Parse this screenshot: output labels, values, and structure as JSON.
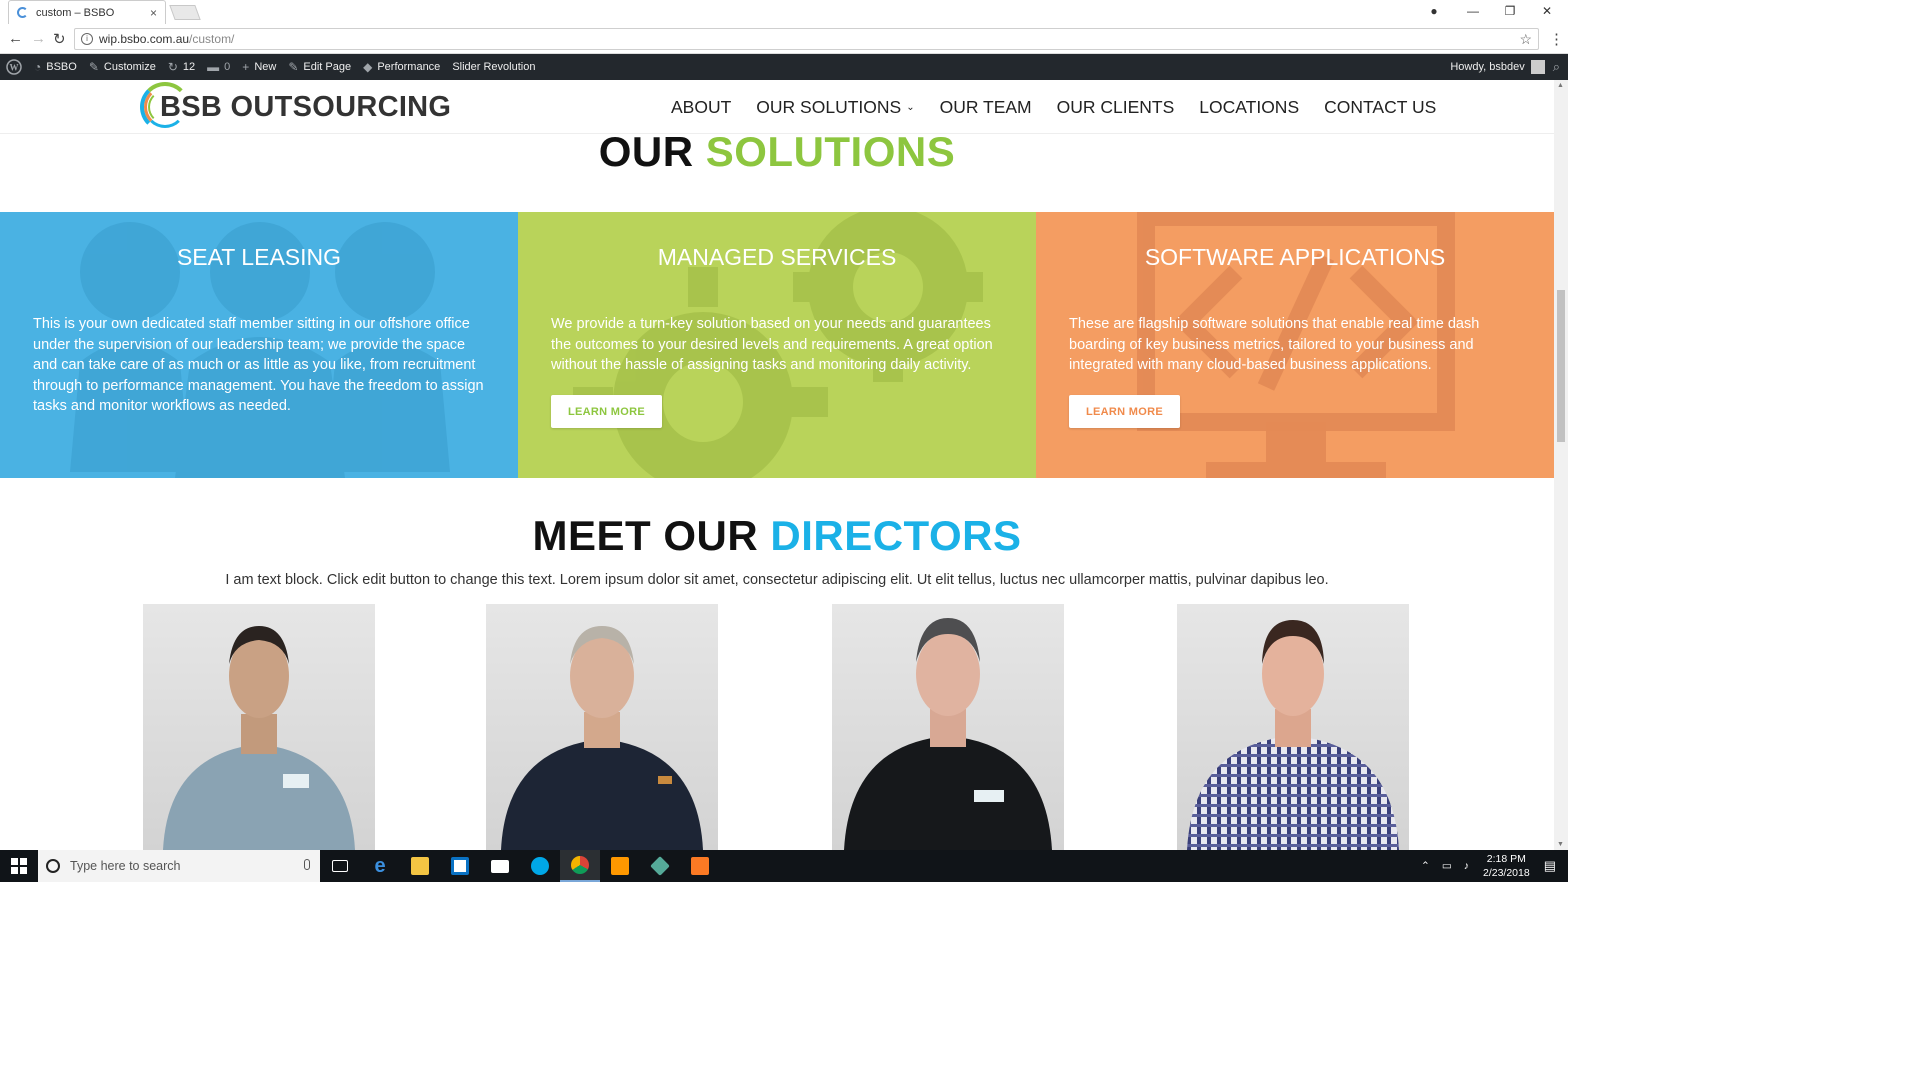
{
  "browser": {
    "tab_title": "custom – BSBO",
    "tab_close": "×",
    "url_host": "wip.bsbo.com.au",
    "url_path": "/custom/",
    "controls": {
      "minimize": "—",
      "maximize": "❐",
      "close": "✕",
      "back": "←",
      "forward": "→",
      "reload": "↻",
      "star": "☆",
      "menu": "⋮",
      "profile": "●"
    }
  },
  "wp_admin_bar": {
    "site": "BSBO",
    "customize": "Customize",
    "updates": "12",
    "comments": "0",
    "new": "New",
    "edit_page": "Edit Page",
    "performance": "Performance",
    "slider": "Slider Revolution",
    "howdy": "Howdy, bsbdev"
  },
  "site": {
    "logo_text": "BSB OUTSOURCING",
    "nav": [
      {
        "label": "ABOUT"
      },
      {
        "label": "OUR SOLUTIONS",
        "caret": "⌄"
      },
      {
        "label": "OUR TEAM"
      },
      {
        "label": "OUR CLIENTS"
      },
      {
        "label": "LOCATIONS"
      },
      {
        "label": "CONTACT US"
      }
    ]
  },
  "solutions": {
    "heading_a": "OUR ",
    "heading_b": "SOLUTIONS",
    "cards": [
      {
        "title": "SEAT LEASING",
        "text": "This is your own dedicated staff member sitting in our offshore office under the supervision of our leadership team; we provide the space and can take care of as much or as little as you like, from recruitment through to performance management. You have the freedom to assign tasks and monitor workflows as needed.",
        "color": "#4ab2e3"
      },
      {
        "title": "MANAGED SERVICES",
        "text": "We provide a turn-key solution based on your needs and guarantees the outcomes to your desired levels and requirements. A great option without the hassle of assigning tasks and monitoring daily activity.",
        "button": "LEARN MORE",
        "color": "#b9d35a",
        "button_text_color": "#8dc63f"
      },
      {
        "title": "SOFTWARE APPLICATIONS",
        "text": "These are flagship software solutions that enable real time dash boarding of key business metrics, tailored to your business and integrated with many cloud-based business applications.",
        "button": "LEARN MORE",
        "color": "#f49d62",
        "button_text_color": "#f08a4b"
      }
    ]
  },
  "directors": {
    "heading_a": "MEET OUR ",
    "heading_b": "DIRECTORS",
    "text": "I am text block. Click edit button to change this text. Lorem ipsum dolor sit amet, consectetur adipiscing elit. Ut elit tellus, luctus nec ullamcorper mattis, pulvinar dapibus leo."
  },
  "taskbar": {
    "search_placeholder": "Type here to search",
    "time": "2:18 PM",
    "date": "2/23/2018"
  }
}
